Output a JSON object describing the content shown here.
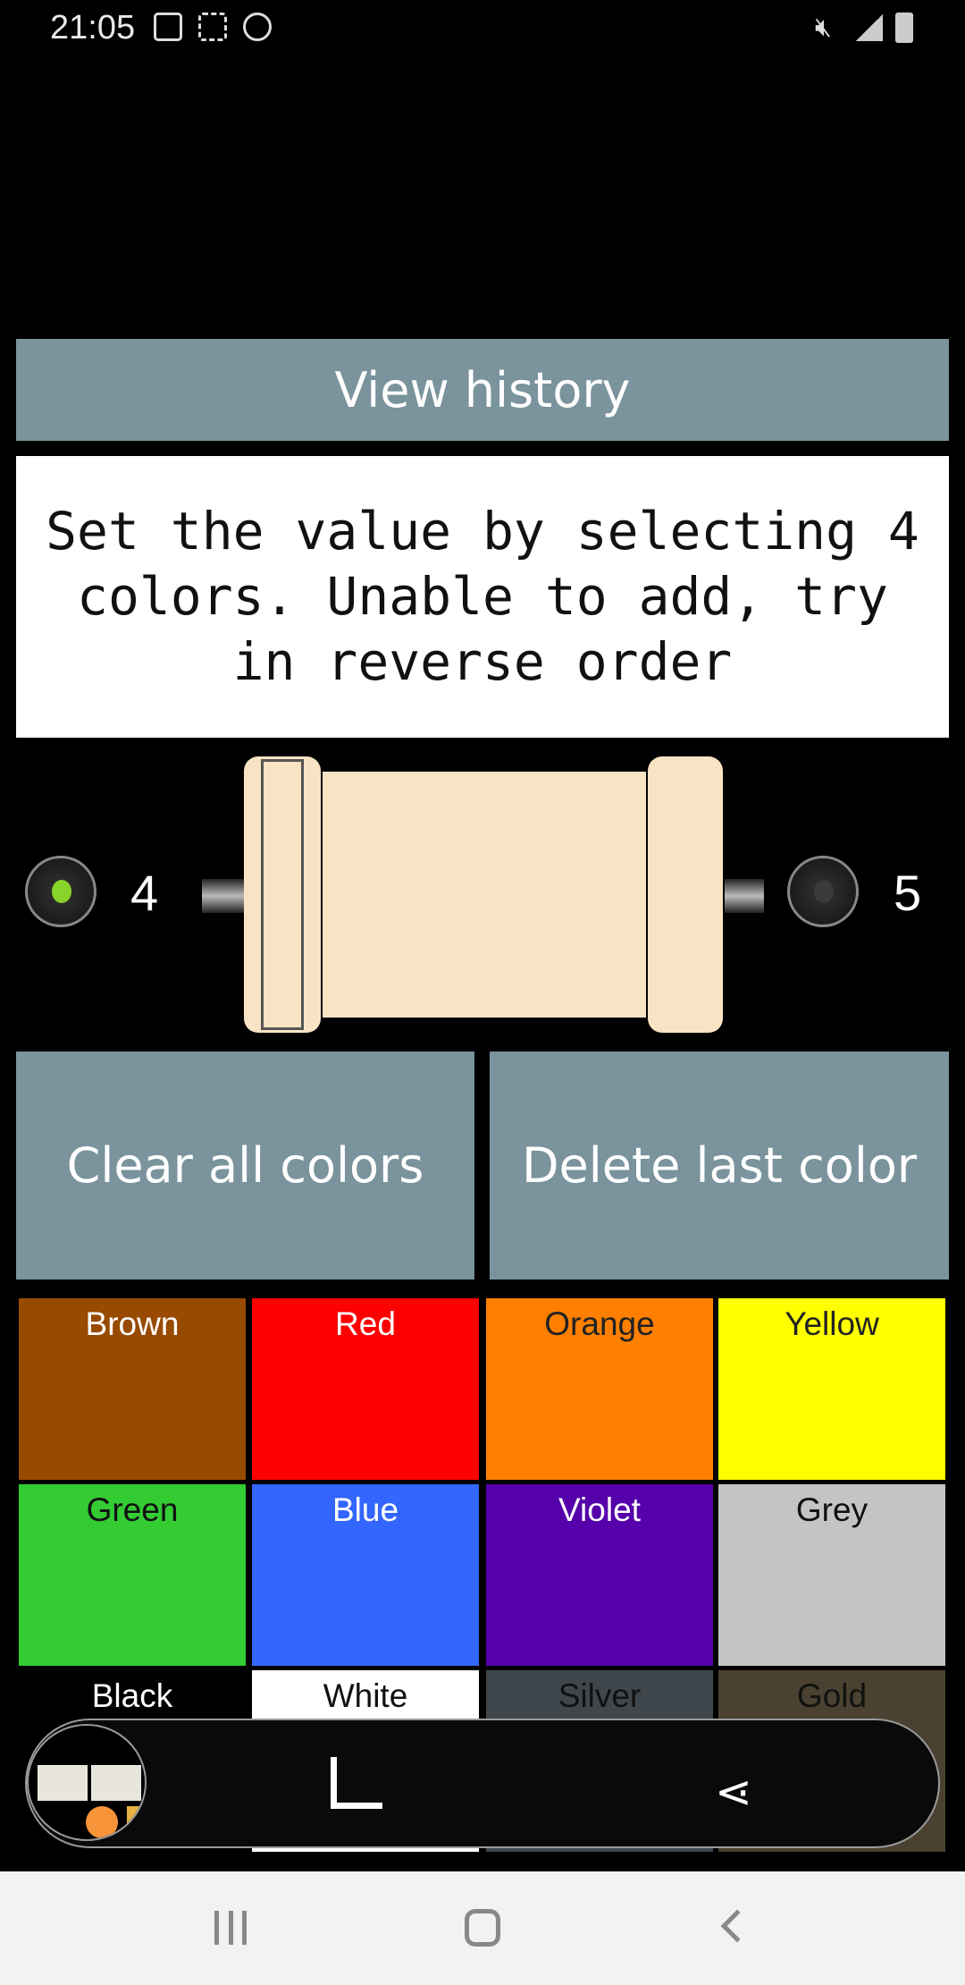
{
  "status_bar": {
    "time": "21:05",
    "icons": [
      "image-icon",
      "screenshot-icon",
      "sync-icon",
      "mute-icon",
      "signal-icon",
      "battery-icon"
    ]
  },
  "view_history_label": "View history",
  "message": "Set the value by selecting 4 colors. Unable to add, try in reverse order",
  "band_options": {
    "left": {
      "label": "4",
      "selected": true
    },
    "right": {
      "label": "5",
      "selected": false
    }
  },
  "actions": {
    "clear_label": "Clear all colors",
    "delete_label": "Delete last color"
  },
  "colors": [
    {
      "label": "Brown",
      "bg": "#984a00",
      "fg": "#ffffff"
    },
    {
      "label": "Red",
      "bg": "#ff0000",
      "fg": "#ffffff"
    },
    {
      "label": "Orange",
      "bg": "#ff8000",
      "fg": "#222222"
    },
    {
      "label": "Yellow",
      "bg": "#ffff00",
      "fg": "#222222"
    },
    {
      "label": "Green",
      "bg": "#33cc33",
      "fg": "#111111"
    },
    {
      "label": "Blue",
      "bg": "#3366ff",
      "fg": "#ffffff"
    },
    {
      "label": "Violet",
      "bg": "#5500aa",
      "fg": "#ffffff"
    },
    {
      "label": "Grey",
      "bg": "#c4c4c4",
      "fg": "#111111"
    },
    {
      "label": "Black",
      "bg": "#000000",
      "fg": "#ffffff"
    },
    {
      "label": "White",
      "bg": "#ffffff",
      "fg": "#111111"
    },
    {
      "label": "Silver",
      "bg": "#40474c",
      "fg": "#111111"
    },
    {
      "label": "Gold",
      "bg": "#4a4130",
      "fg": "#111111"
    }
  ],
  "accent_colors": {
    "button": "#7a939c",
    "resistor_body": "#f8e3c4",
    "led_on": "#88d42a"
  },
  "screenshot_toolbar": {
    "icons": [
      "screenshot-thumbnail",
      "crop-edit-icon",
      "share-icon"
    ]
  },
  "nav_bar": {
    "icons": [
      "recents-icon",
      "home-icon",
      "back-icon"
    ]
  }
}
